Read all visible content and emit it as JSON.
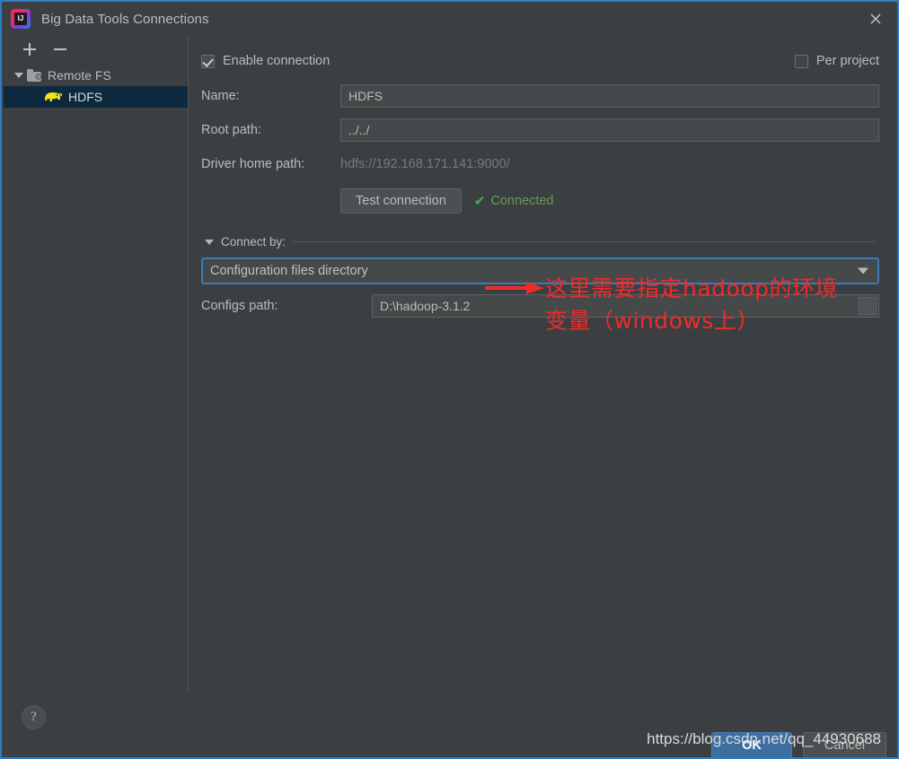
{
  "window": {
    "title": "Big Data Tools Connections",
    "app_icon": "intellij-idea-icon",
    "close_icon": "close-icon",
    "accent_blue": "#2e7cc4",
    "background": "#3c3f41"
  },
  "sidebar": {
    "toolbar": {
      "add_icon": "plus-icon",
      "remove_icon": "minus-icon"
    },
    "tree": [
      {
        "label": "Remote FS",
        "icon": "folder-remote-fs-icon",
        "expanded": true,
        "selected": false
      },
      {
        "label": "HDFS",
        "icon": "hadoop-elephant-icon",
        "expanded": false,
        "selected": true
      }
    ]
  },
  "form": {
    "enable_connection": {
      "label": "Enable connection",
      "checked": true
    },
    "per_project": {
      "label": "Per project",
      "checked": false
    },
    "name": {
      "label": "Name:",
      "value": "HDFS"
    },
    "root_path": {
      "label": "Root path:",
      "value": "../../"
    },
    "driver_home_path": {
      "label": "Driver home path:",
      "value": "hdfs://192.168.171.141:9000/"
    },
    "test_connection": {
      "label": "Test connection"
    },
    "connection_status": {
      "label": "Connected",
      "icon": "check-icon",
      "color": "#6a9955"
    },
    "connect_by": {
      "label": "Connect by:",
      "expanded": true,
      "selected_option": "Configuration files directory",
      "dropdown_icon": "chevron-down-icon"
    },
    "configs_path": {
      "label": "Configs path:",
      "value": "D:\\hadoop-3.1.2",
      "browse_icon": "folder-browse-icon"
    }
  },
  "annotation": {
    "color": "#ef2b2b",
    "arrow_icon": "right-arrow-icon",
    "line1": "这里需要指定hadoop的环境",
    "line2": "变量（windows上）"
  },
  "footer": {
    "help_label": "?",
    "help_icon": "help-question-icon",
    "ok_label": "OK",
    "cancel_label": "Cancel",
    "watermark": "https://blog.csdn.net/qq_44930688"
  }
}
